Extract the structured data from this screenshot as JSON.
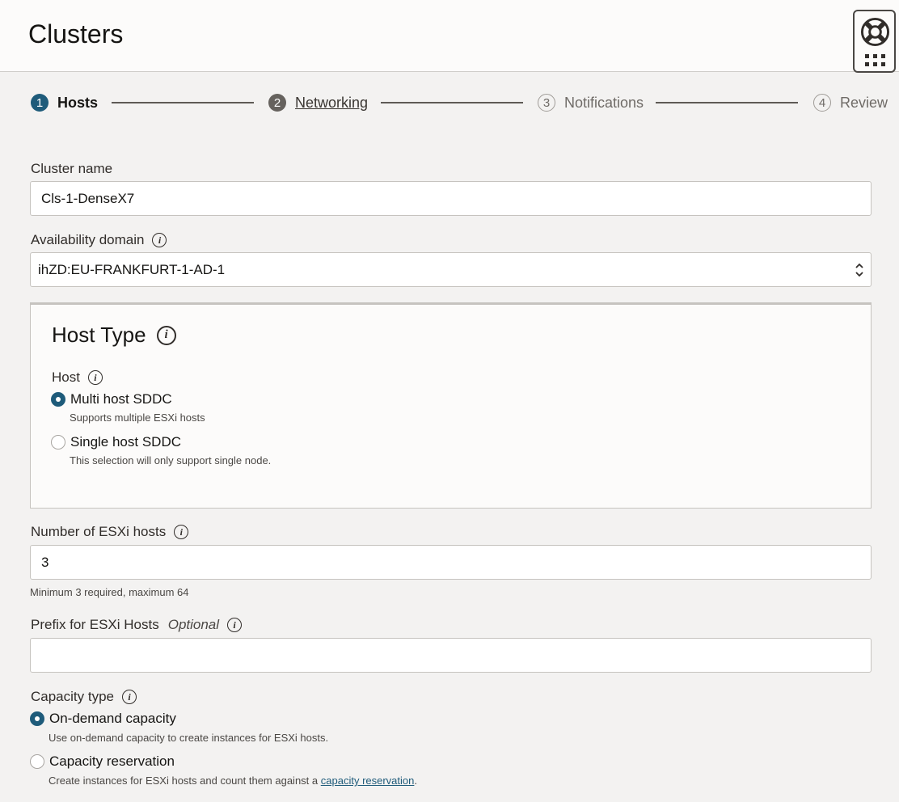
{
  "header": {
    "title": "Clusters"
  },
  "steps": [
    {
      "number": "1",
      "label": "Hosts",
      "state": "active"
    },
    {
      "number": "2",
      "label": "Networking",
      "state": "visited"
    },
    {
      "number": "3",
      "label": "Notifications",
      "state": "future"
    },
    {
      "number": "4",
      "label": "Review",
      "state": "future"
    }
  ],
  "form": {
    "cluster_name": {
      "label": "Cluster name",
      "value": "Cls-1-DenseX7"
    },
    "availability_domain": {
      "label": "Availability domain",
      "value": "ihZD:EU-FRANKFURT-1-AD-1"
    },
    "host_type": {
      "title": "Host Type",
      "host_label": "Host",
      "options": [
        {
          "label": "Multi host SDDC",
          "description": "Supports multiple ESXi hosts",
          "selected": true
        },
        {
          "label": "Single host SDDC",
          "description": "This selection will only support single node.",
          "selected": false
        }
      ]
    },
    "esxi_hosts": {
      "label": "Number of ESXi hosts",
      "value": "3",
      "hint": "Minimum 3 required, maximum 64"
    },
    "prefix": {
      "label": "Prefix for ESXi Hosts",
      "optional": "Optional",
      "value": ""
    },
    "capacity_type": {
      "label": "Capacity type",
      "options": [
        {
          "label": "On-demand capacity",
          "description": "Use on-demand capacity to create instances for ESXi hosts.",
          "selected": true
        },
        {
          "label": "Capacity reservation",
          "description": "Create instances for ESXi hosts and count them against a",
          "link": "capacity reservation",
          "suffix": ".",
          "selected": false
        }
      ]
    }
  },
  "icons": {
    "help": "lifebuoy-icon",
    "apps": "grid-icon",
    "info": "info-icon",
    "select": "chevron-updown-icon"
  },
  "colors": {
    "accent": "#1e5b7a",
    "background": "#f3f2f1",
    "panel": "#fcfbfa"
  }
}
